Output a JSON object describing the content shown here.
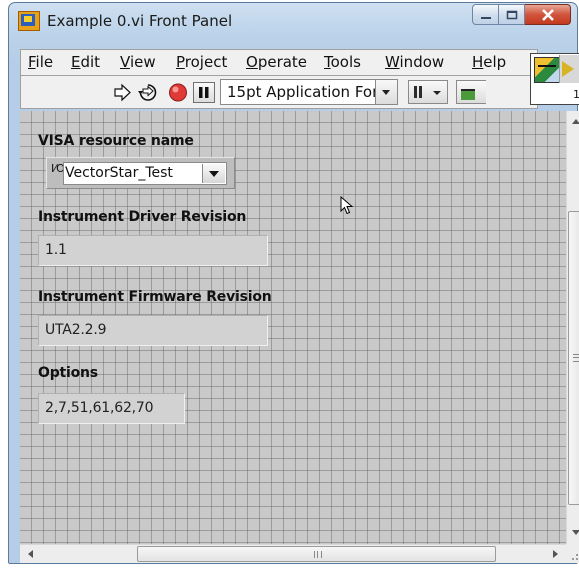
{
  "window": {
    "title": "Example 0.vi Front Panel"
  },
  "menu": {
    "items": [
      {
        "pre": "",
        "key": "F",
        "post": "ile"
      },
      {
        "pre": "",
        "key": "E",
        "post": "dit"
      },
      {
        "pre": "",
        "key": "V",
        "post": "iew"
      },
      {
        "pre": "",
        "key": "P",
        "post": "roject"
      },
      {
        "pre": "",
        "key": "O",
        "post": "perate"
      },
      {
        "pre": "",
        "key": "T",
        "post": "ools"
      },
      {
        "pre": "",
        "key": "W",
        "post": "indow"
      },
      {
        "pre": "",
        "key": "H",
        "post": "elp"
      }
    ]
  },
  "toolbar": {
    "font": "15pt Application Font",
    "icons": [
      "run-arrow-icon",
      "run-continuously-icon",
      "abort-execution-icon",
      "pause-icon",
      "text-settings-dropdown-icon",
      "align-objects-icon",
      "distribute-objects-icon"
    ]
  },
  "vi_icon": {
    "connector_number": "1"
  },
  "controls": {
    "visa": {
      "label": "VISA resource name",
      "icon_glyph": "I⁄O",
      "value": "VectorStar_Test"
    },
    "driver_rev": {
      "label": "Instrument Driver Revision",
      "value": "1.1"
    },
    "firmware_rev": {
      "label": "Instrument Firmware Revision",
      "value": "UTA2.2.9"
    },
    "options": {
      "label": "Options",
      "value": "2,7,51,61,62,70"
    }
  },
  "colors": {
    "panel_bg": "#c9c9c9",
    "grid": "#5a5a5a",
    "abort_red": "#e03a36",
    "title_bar": "#bcd3ea",
    "close_button": "#c23b1f"
  }
}
